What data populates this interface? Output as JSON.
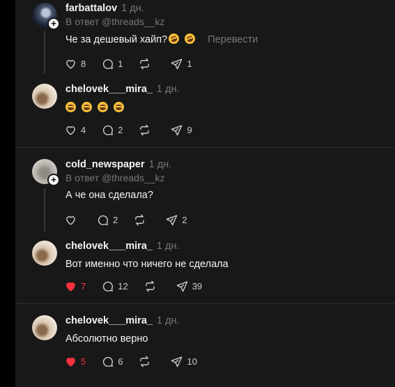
{
  "posts": [
    {
      "username": "farbattalov",
      "time": "1 дн.",
      "reply_to": "В ответ @threads__kz",
      "text": "Че за дешевый хайп?",
      "emojis": [
        "rofl",
        "rofl"
      ],
      "translate": "Перевести",
      "likes": "8",
      "replies": "1",
      "reposts": "",
      "shares": "1",
      "liked": false,
      "avatar": "avatar-dark"
    },
    {
      "username": "chelovek___mira_",
      "time": "1 дн.",
      "text": "",
      "emojis": [
        "grin",
        "grin",
        "grin",
        "grin"
      ],
      "likes": "4",
      "replies": "2",
      "reposts": "",
      "shares": "9",
      "liked": false,
      "avatar": "avatar-cup"
    },
    {
      "username": "cold_newspaper",
      "time": "1 дн.",
      "reply_to": "В ответ @threads__kz",
      "text": "А че она сделала?",
      "likes": "",
      "replies": "2",
      "reposts": "",
      "shares": "2",
      "liked": false,
      "avatar": "avatar-cat"
    },
    {
      "username": "chelovek___mira_",
      "time": "1 дн.",
      "text": "Вот именно что ничего не сделала",
      "likes": "7",
      "replies": "12",
      "reposts": "",
      "shares": "39",
      "liked": true,
      "avatar": "avatar-cup"
    },
    {
      "username": "chelovek___mira_",
      "time": "1 дн.",
      "text": "Абсолютно верно",
      "likes": "5",
      "replies": "6",
      "reposts": "",
      "shares": "10",
      "liked": true,
      "avatar": "avatar-cup"
    }
  ],
  "colors": {
    "background": "#181818",
    "text": "#f3f5f7",
    "muted": "#777777",
    "like_active": "#ff3040"
  },
  "icons": {
    "like": "heart-icon",
    "reply": "comment-icon",
    "repost": "repost-icon",
    "share": "send-icon",
    "follow": "plus-icon"
  }
}
